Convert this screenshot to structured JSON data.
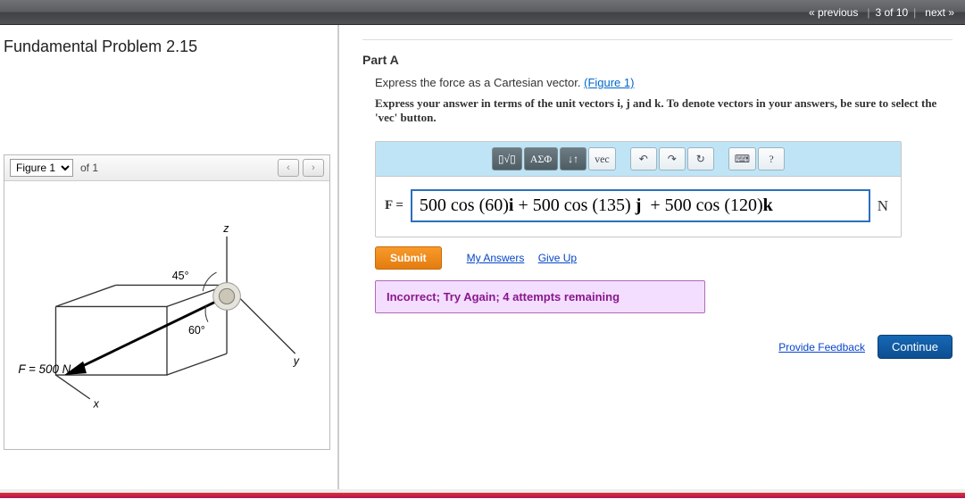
{
  "nav": {
    "prev": "« previous",
    "position": "3 of 10",
    "next": "next »"
  },
  "problem_title": "Fundamental Problem 2.15",
  "figure": {
    "select_label": "Figure 1",
    "of_text": "of 1",
    "prev_glyph": "‹",
    "next_glyph": "›",
    "force_label": "F = 500 N",
    "angle1": "45°",
    "angle2": "60°",
    "axis_x": "x",
    "axis_y": "y",
    "axis_z": "z"
  },
  "part": {
    "title": "Part A",
    "instruction": "Express the force as a Cartesian vector. ",
    "figlink": "(Figure 1)",
    "format_hint_pre": "Express your answer in terms of the unit vectors ",
    "format_hint_mid": " and ",
    "format_hint_post": ". To denote vectors in your answers, be sure to select the 'vec' button.",
    "sym_i": "i",
    "sym_j": "j",
    "sym_k": "k"
  },
  "toolbar": {
    "templates": "▯√▯",
    "greek": "ΑΣΦ",
    "arrows": "↓↑",
    "vec": "vec",
    "undo": "↶",
    "redo": "↷",
    "reset": "↻",
    "keyboard": "⌨",
    "help": "?"
  },
  "answer": {
    "lhs": "F =",
    "value_plain": "500 cos (60)i + 500 cos (135) j  + 500 cos (120)k",
    "unit": "N"
  },
  "actions": {
    "submit": "Submit",
    "my_answers": "My Answers",
    "give_up": "Give Up"
  },
  "feedback": "Incorrect; Try Again; 4 attempts remaining",
  "bottom": {
    "provide_feedback": "Provide Feedback",
    "continue": "Continue"
  }
}
